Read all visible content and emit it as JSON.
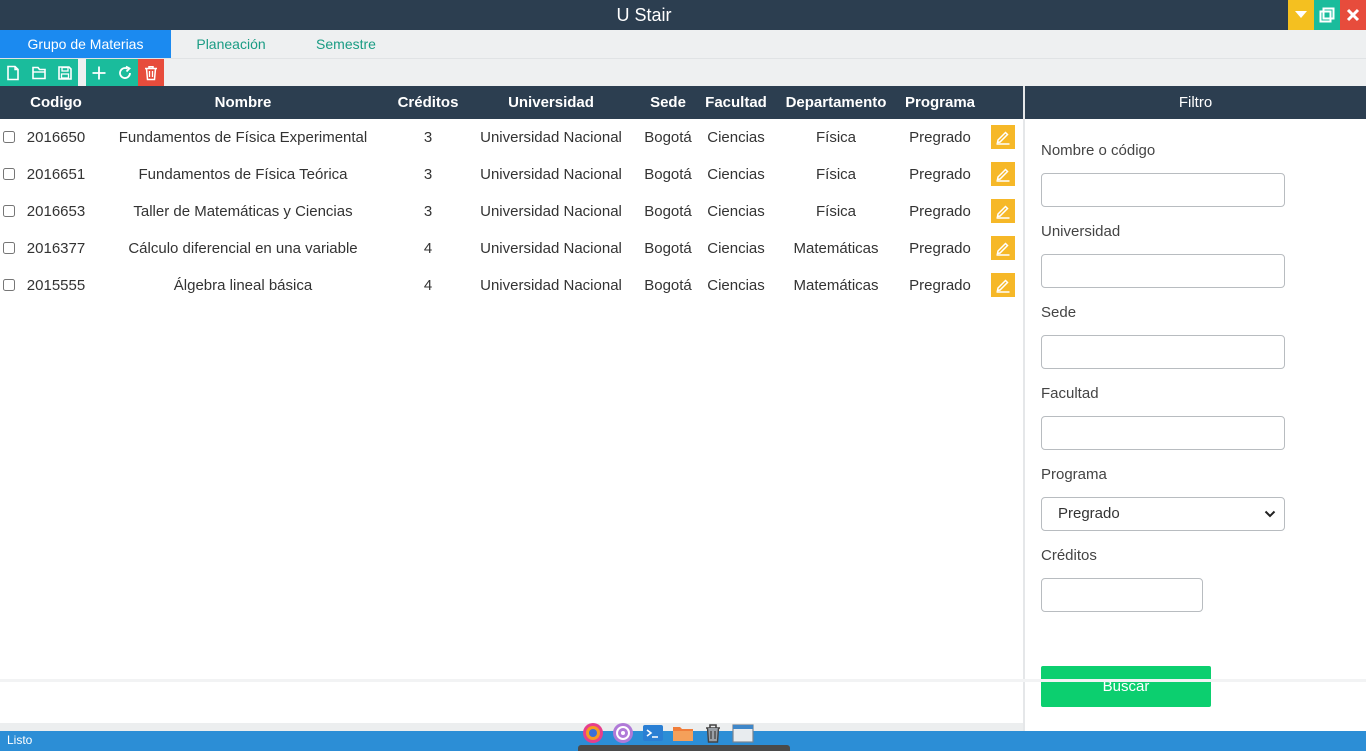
{
  "window": {
    "title": "U Stair",
    "controls": [
      "minimize-icon",
      "maximize-icon",
      "close-icon"
    ]
  },
  "tabs": [
    {
      "label": "Grupo de Materias",
      "active": true
    },
    {
      "label": "Planeación",
      "active": false
    },
    {
      "label": "Semestre",
      "active": false
    }
  ],
  "toolbar": {
    "buttons": [
      "new-file-icon",
      "open-folder-icon",
      "save-icon",
      "add-icon",
      "refresh-icon",
      "delete-icon"
    ]
  },
  "table": {
    "columns": [
      "Codigo",
      "Nombre",
      "Créditos",
      "Universidad",
      "Sede",
      "Facultad",
      "Departamento",
      "Programa"
    ],
    "rows": [
      {
        "codigo": "2016650",
        "nombre": "Fundamentos de Física Experimental",
        "creditos": "3",
        "universidad": "Universidad Nacional",
        "sede": "Bogotá",
        "facultad": "Ciencias",
        "departamento": "Física",
        "programa": "Pregrado"
      },
      {
        "codigo": "2016651",
        "nombre": "Fundamentos de Física Teórica",
        "creditos": "3",
        "universidad": "Universidad Nacional",
        "sede": "Bogotá",
        "facultad": "Ciencias",
        "departamento": "Física",
        "programa": "Pregrado"
      },
      {
        "codigo": "2016653",
        "nombre": "Taller de Matemáticas y Ciencias",
        "creditos": "3",
        "universidad": "Universidad Nacional",
        "sede": "Bogotá",
        "facultad": "Ciencias",
        "departamento": "Física",
        "programa": "Pregrado"
      },
      {
        "codigo": "2016377",
        "nombre": "Cálculo diferencial en una variable",
        "creditos": "4",
        "universidad": "Universidad Nacional",
        "sede": "Bogotá",
        "facultad": "Ciencias",
        "departamento": "Matemáticas",
        "programa": "Pregrado"
      },
      {
        "codigo": "2015555",
        "nombre": "Álgebra lineal básica",
        "creditos": "4",
        "universidad": "Universidad Nacional",
        "sede": "Bogotá",
        "facultad": "Ciencias",
        "departamento": "Matemáticas",
        "programa": "Pregrado"
      }
    ]
  },
  "filter": {
    "title": "Filtro",
    "nombre_label": "Nombre o código",
    "nombre_value": "",
    "universidad_label": "Universidad",
    "universidad_value": "",
    "sede_label": "Sede",
    "sede_value": "",
    "facultad_label": "Facultad",
    "facultad_value": "",
    "programa_label": "Programa",
    "programa_selected": "Pregrado",
    "creditos_label": "Créditos",
    "creditos_value": "",
    "search_button": "Buscar"
  },
  "status": {
    "text": "Listo"
  },
  "taskbar": {
    "icons": [
      "browser-icon",
      "app-icon",
      "terminal-icon",
      "folder-icon",
      "trash-icon",
      "window-icon"
    ]
  },
  "colors": {
    "header": "#2c3e50",
    "accent": "#1abc9c",
    "active_tab": "#1b8af0",
    "edit_button": "#f6b828",
    "delete_button": "#e74c3c",
    "search_button": "#0ccf6f",
    "statusbar": "#2c8ed6"
  }
}
